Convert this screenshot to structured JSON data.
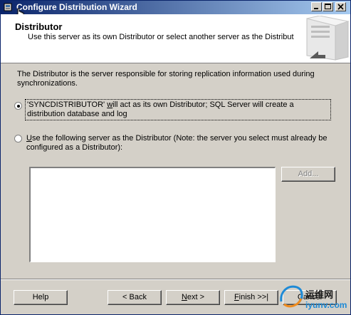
{
  "window": {
    "title": "Configure Distribution Wizard"
  },
  "header": {
    "title": "Distributor",
    "subtitle": "Use this server as its own Distributor or select another server as the Distributor."
  },
  "content": {
    "description": "The Distributor is the server responsible for storing replication information used during synchronizations.",
    "option1": {
      "pre": "'SYNCDISTRIBUTOR' ",
      "accel": "w",
      "post": "ill act as its own Distributor; SQL Server will create a distribution database and log",
      "selected": true
    },
    "option2": {
      "accel": "U",
      "post": "se the following server as the Distributor (Note: the server you select must already be configured as a Distributor):",
      "selected": false
    },
    "server_list": [],
    "add_button": "Add..."
  },
  "buttons": {
    "help": "Help",
    "back": "< Back",
    "next_accel": "N",
    "next_rest": "ext >",
    "finish_accel": "F",
    "finish_rest": "inish >>|",
    "cancel": "Cancel"
  },
  "watermark": {
    "line1": "运维网",
    "line2": "iyunv.com"
  }
}
